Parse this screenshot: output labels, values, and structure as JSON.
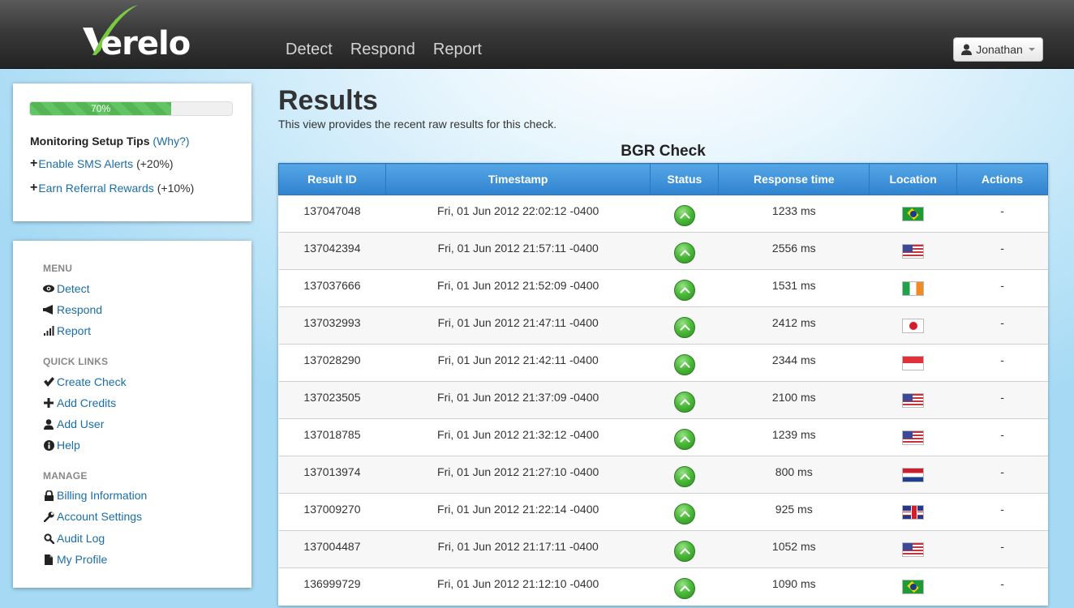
{
  "header": {
    "logo_text": "erelo",
    "nav": [
      "Detect",
      "Respond",
      "Report"
    ],
    "user": "Jonathan"
  },
  "tips": {
    "progress_percent": 70,
    "progress_label": "70%",
    "title": "Monitoring Setup Tips",
    "why_link": "(Why?)",
    "items": [
      {
        "link": "Enable SMS Alerts",
        "bonus": "(+20%)"
      },
      {
        "link": "Earn Referral Rewards",
        "bonus": "(+10%)"
      }
    ]
  },
  "menu": {
    "sections": [
      {
        "heading": "MENU",
        "items": [
          {
            "label": "Detect",
            "icon": "eye-icon"
          },
          {
            "label": "Respond",
            "icon": "megaphone-icon"
          },
          {
            "label": "Report",
            "icon": "signal-bars-icon"
          }
        ]
      },
      {
        "heading": "QUICK LINKS",
        "items": [
          {
            "label": "Create Check",
            "icon": "checkmark-icon"
          },
          {
            "label": "Add Credits",
            "icon": "plus-icon"
          },
          {
            "label": "Add User",
            "icon": "user-icon"
          },
          {
            "label": "Help",
            "icon": "info-icon"
          }
        ]
      },
      {
        "heading": "MANAGE",
        "items": [
          {
            "label": "Billing Information",
            "icon": "lock-icon"
          },
          {
            "label": "Account Settings",
            "icon": "wrench-icon"
          },
          {
            "label": "Audit Log",
            "icon": "search-icon"
          },
          {
            "label": "My Profile",
            "icon": "file-icon"
          }
        ]
      }
    ]
  },
  "main": {
    "title": "Results",
    "subtitle": "This view provides the recent raw results for this check.",
    "table_title": "BGR Check",
    "columns": [
      "Result ID",
      "Timestamp",
      "Status",
      "Response time",
      "Location",
      "Actions"
    ],
    "rows": [
      {
        "id": "137047048",
        "timestamp": "Fri, 01 Jun 2012 22:02:12 -0400",
        "status": "up",
        "response": "1233 ms",
        "location": "br",
        "action": "-"
      },
      {
        "id": "137042394",
        "timestamp": "Fri, 01 Jun 2012 21:57:11 -0400",
        "status": "up",
        "response": "2556 ms",
        "location": "us",
        "action": "-"
      },
      {
        "id": "137037666",
        "timestamp": "Fri, 01 Jun 2012 21:52:09 -0400",
        "status": "up",
        "response": "1531 ms",
        "location": "ie",
        "action": "-"
      },
      {
        "id": "137032993",
        "timestamp": "Fri, 01 Jun 2012 21:47:11 -0400",
        "status": "up",
        "response": "2412 ms",
        "location": "jp",
        "action": "-"
      },
      {
        "id": "137028290",
        "timestamp": "Fri, 01 Jun 2012 21:42:11 -0400",
        "status": "up",
        "response": "2344 ms",
        "location": "sg",
        "action": "-"
      },
      {
        "id": "137023505",
        "timestamp": "Fri, 01 Jun 2012 21:37:09 -0400",
        "status": "up",
        "response": "2100 ms",
        "location": "us",
        "action": "-"
      },
      {
        "id": "137018785",
        "timestamp": "Fri, 01 Jun 2012 21:32:12 -0400",
        "status": "up",
        "response": "1239 ms",
        "location": "us",
        "action": "-"
      },
      {
        "id": "137013974",
        "timestamp": "Fri, 01 Jun 2012 21:27:10 -0400",
        "status": "up",
        "response": "800 ms",
        "location": "nl",
        "action": "-"
      },
      {
        "id": "137009270",
        "timestamp": "Fri, 01 Jun 2012 21:22:14 -0400",
        "status": "up",
        "response": "925 ms",
        "location": "gb",
        "action": "-"
      },
      {
        "id": "137004487",
        "timestamp": "Fri, 01 Jun 2012 21:17:11 -0400",
        "status": "up",
        "response": "1052 ms",
        "location": "us",
        "action": "-"
      },
      {
        "id": "136999729",
        "timestamp": "Fri, 01 Jun 2012 21:12:10 -0400",
        "status": "up",
        "response": "1090 ms",
        "location": "br",
        "action": "-"
      }
    ]
  },
  "colors": {
    "header_dark": "#232323",
    "link_blue": "#1a6ea8",
    "table_header_blue": "#3a8fd8",
    "progress_green": "#62c462",
    "status_up_green": "#4dbb3a",
    "logo_green": "#7ac943"
  }
}
